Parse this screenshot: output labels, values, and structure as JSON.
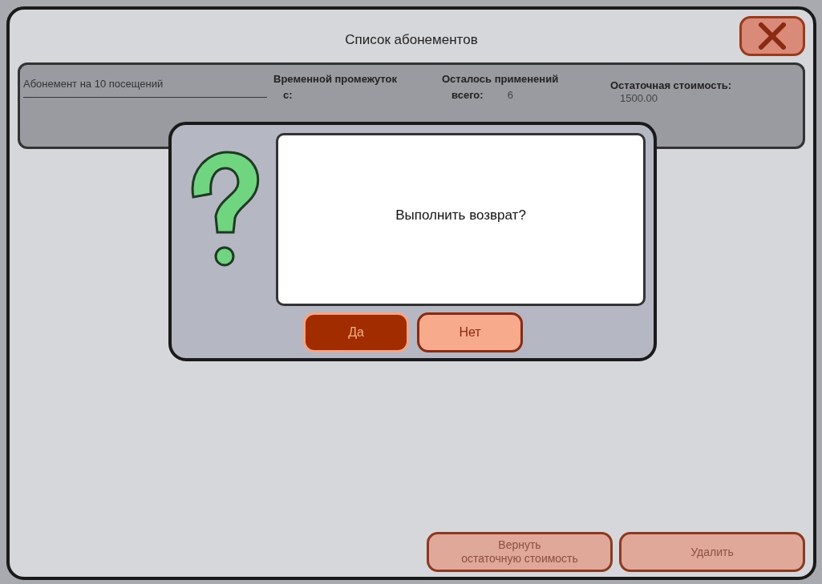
{
  "window": {
    "title": "Список абонементов"
  },
  "subscription": {
    "name": "Абонемент на 10 посещений",
    "period_label": "Временной промежуток",
    "period_from": "с:",
    "uses_label": "Осталось применений",
    "uses_total_label": "всего:",
    "uses_total": "6",
    "balance_label": "Остаточная стоимость:",
    "balance": "1500.00"
  },
  "actions": [
    {
      "label": "Вернуть\nостаточную стоимость",
      "disabled": true
    },
    {
      "label": "Удалить",
      "disabled": true
    }
  ],
  "dialog": {
    "message": "Выполнить возврат?",
    "buttons": [
      {
        "label": "Да",
        "selected": true
      },
      {
        "label": "Нет",
        "selected": false
      }
    ]
  }
}
